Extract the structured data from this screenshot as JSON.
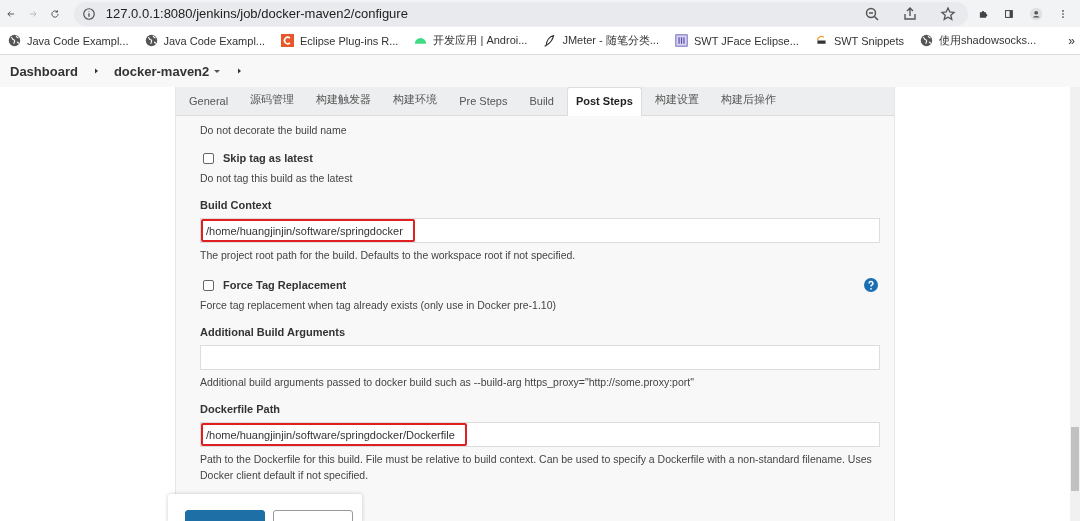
{
  "browser": {
    "url": "127.0.0.1:8080/jenkins/job/docker-maven2/configure"
  },
  "bookmarks": [
    {
      "label": "Java Code Exampl...",
      "kind": "globe"
    },
    {
      "label": "Java Code Exampl...",
      "kind": "globe"
    },
    {
      "label": "Eclipse Plug-ins R...",
      "kind": "tile"
    },
    {
      "label": "开发应用 | Androi...",
      "kind": "android"
    },
    {
      "label": "JMeter - 随笔分类...",
      "kind": "feather"
    },
    {
      "label": "SWT JFace Eclipse...",
      "kind": "book"
    },
    {
      "label": "SWT Snippets",
      "kind": "swirl"
    },
    {
      "label": "使用shadowsocks...",
      "kind": "globe"
    }
  ],
  "bookmarks_more": "»",
  "breadcrumb": [
    {
      "label": "Dashboard",
      "dropdown": false
    },
    {
      "label": "docker-maven2",
      "dropdown": true
    }
  ],
  "tabs": [
    {
      "label": "General",
      "selected": false
    },
    {
      "label": "源码管理",
      "selected": false
    },
    {
      "label": "构建触发器",
      "selected": false
    },
    {
      "label": "构建环境",
      "selected": false
    },
    {
      "label": "Pre Steps",
      "selected": false
    },
    {
      "label": "Build",
      "selected": false
    },
    {
      "label": "Post Steps",
      "selected": true
    },
    {
      "label": "构建设置",
      "selected": false
    },
    {
      "label": "构建后操作",
      "selected": false
    }
  ],
  "form": [
    {
      "kind": "note",
      "help": "Do not decorate the build name"
    },
    {
      "kind": "checkbox",
      "label": "Skip tag as latest",
      "checked": false,
      "help_icon": false,
      "help": "Do not tag this build as the latest"
    },
    {
      "kind": "text",
      "label": "Build Context",
      "value": "/home/huangjinjin/software/springdocker",
      "highlighted": true,
      "help": "The project root path for the build. Defaults to the workspace root if not specified."
    },
    {
      "kind": "checkbox",
      "label": "Force Tag Replacement",
      "checked": false,
      "help_icon": true,
      "help": "Force tag replacement when tag already exists (only use in Docker pre-1.10)"
    },
    {
      "kind": "text",
      "label": "Additional Build Arguments",
      "highlighted": false,
      "help": "Additional build arguments passed to docker build such as --build-arg https_proxy=\"http://some.proxy:port\""
    },
    {
      "kind": "text",
      "label": "Dockerfile Path",
      "value": "/home/huangjinjin/software/springdocker/Dockerfile",
      "highlighted": true,
      "help": "Path to the Dockerfile for this build. File must be relative to build context. Can be used to specify a Dockerfile with a non-standard filename. Uses Docker client default if not specified."
    }
  ],
  "buttons": [
    {
      "kind": "primary"
    },
    {
      "kind": "secondary"
    }
  ]
}
